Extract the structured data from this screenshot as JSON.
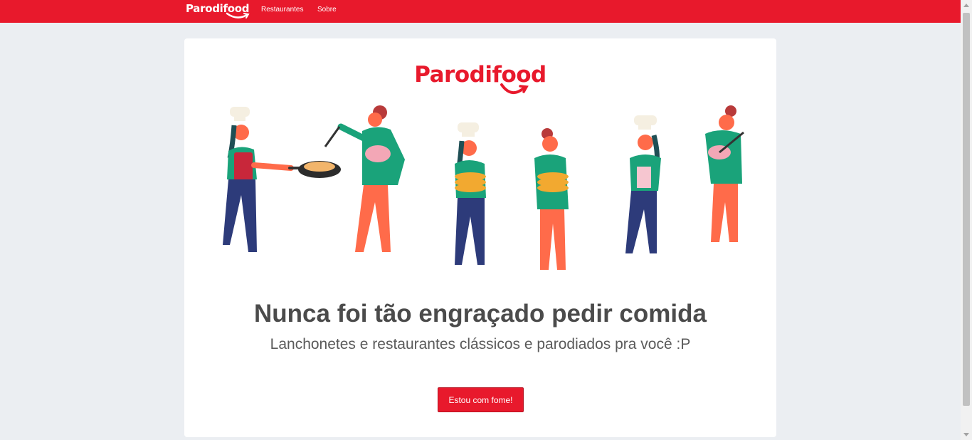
{
  "navbar": {
    "brand": "Parodifood",
    "links": [
      "Restaurantes",
      "Sobre"
    ]
  },
  "hero": {
    "logo_text": "Parodifood",
    "title": "Nunca foi tão engraçado pedir comida",
    "subtitle": "Lanchonetes e restaurantes clássicos e parodiados pra você :P",
    "cta_label": "Estou com fome!"
  },
  "colors": {
    "brand_red": "#e8192c",
    "background": "#ebeef2",
    "card": "#ffffff",
    "text_dark": "#4b4b4b"
  },
  "icons": [
    "smile-arrow-icon",
    "cooks-illustration"
  ]
}
